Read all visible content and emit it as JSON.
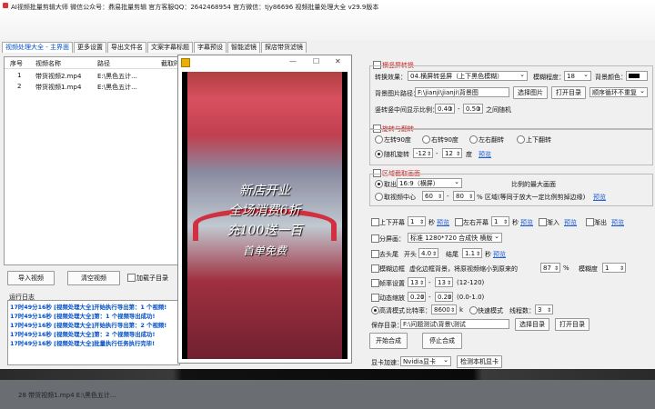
{
  "app": {
    "title": "AI视频批量剪辑大师   微信公众号：鼎易批量剪辑   官方客服QQ：2642468954   官方微信：tjy86696   视频批量处理大全  v29.9版本"
  },
  "tabs": [
    "视频处理大全 - 主界面",
    "更多设置",
    "导出文件名",
    "文案字幕标题",
    "字幕预设",
    "智能滤镜",
    "探店带货滤镜"
  ],
  "file_table": {
    "headers": [
      "序号",
      "视频名称",
      "路径",
      "截取时"
    ],
    "rows": [
      {
        "idx": "1",
        "name": "带货视频2.mp4",
        "path": "E:\\黑色五计..."
      },
      {
        "idx": "2",
        "name": "带货视频1.mp4",
        "path": "E:\\黑色五计..."
      }
    ]
  },
  "buttons": {
    "import": "导入视频",
    "clear": "清空视频",
    "add_subdir": "加载子目录",
    "select_image": "选择图片",
    "open_dir": "打开目录",
    "loop_mode": "顺序循环不重复",
    "start": "开始合成",
    "stop": "停止合成",
    "select_dir": "选择目录",
    "open_dir2": "打开目录",
    "detect_gpu": "检测本机显卡"
  },
  "log": {
    "label": "运行日志",
    "lines": [
      "17时49分16秒 [视频处理大全]开始执行导出第：1 个视频!",
      "17时49分16秒 [视频处理大全]第：1 个视频导出成功!",
      "17时49分16秒 [视频处理大全]开始执行导出第：2 个视频!",
      "17时49分16秒 [视频处理大全]第：2 个视频导出成功!",
      "17时49分16秒 [视频处理大全]批量执行任务执行完毕!"
    ]
  },
  "settings": {
    "h2v": {
      "title": "横竖屏转换",
      "mode_label": "转换效果：",
      "mode_value": "04.横屏转竖屏（上下黑色模糊）",
      "blur_label": "模糊程度：",
      "blur_value": "18",
      "bgcolor_label": "背景颜色：",
      "bgcolor": "#000000",
      "bgimg_label": "背景图片路径：",
      "bgimg_value": "F:\\jianji\\jianji\\背景图",
      "ratio_label": "竖转竖中间显示比例：",
      "ratio_min": "0.40",
      "ratio_max": "0.50",
      "ratio_suffix": "之间随机"
    },
    "rotate": {
      "title": "旋转与翻转",
      "opt1": "左转90度",
      "opt2": "右转90度",
      "opt3": "左右翻转",
      "opt4": "上下翻转",
      "opt5": "随机旋转",
      "min": "-12",
      "max": "12",
      "unit": "度",
      "preview": "预览"
    },
    "crop": {
      "title": "区域截取画面",
      "take_label": "取出",
      "take_value": "16:9（横屏）",
      "take_suffix": "比例的最大画面",
      "center_label": "取视频中心",
      "center_min": "60",
      "center_max": "80",
      "center_suffix": "% 区域(等同于放大一定比例剪掉边缘)",
      "preview": "预览"
    },
    "misc": {
      "top_bottom": "上下开幕",
      "top_bottom_val": "1",
      "top_bottom_unit": "秒",
      "left_right": "左右开幕",
      "left_right_val": "1",
      "left_right_unit": "秒",
      "fade_in": "渐入",
      "fade_out": "渐出",
      "preview": "预览",
      "split": "分屏画：",
      "split_value": "标准 1280*720 合成快 横版",
      "trim": "去头尾",
      "head_label": "开头",
      "head_val": "4.0",
      "tail_label": "结尾",
      "tail_val": "1.1",
      "trim_unit": "秒",
      "blur_border": "模糊边框",
      "blur_border_desc": "虚化边框背景，将原视频缩小到原来的",
      "blur_border_pct": "87",
      "blur_pct_unit": "%",
      "blur_deg_label": "模糊度",
      "blur_deg_val": "1",
      "fps": "帧率设置",
      "fps_min": "13",
      "fps_max": "13",
      "fps_range": "(12-120)",
      "zoom": "动态缩放",
      "zoom_min": "0.20",
      "zoom_max": "0.20",
      "zoom_range": "(0.0-1.0)",
      "hq": "高清模式",
      "bitrate_label": "比特率：",
      "bitrate_val": "8600",
      "bitrate_unit": "k",
      "fast": "快速模式",
      "threads_label": "线程数：",
      "threads_val": "3",
      "save_label": "保存目录：",
      "save_val": "F:\\问题测试\\背景\\测试",
      "gpu_label": "显卡加速：",
      "gpu_val": "Nvidia显卡"
    }
  },
  "video": {
    "title_ctrls": [
      "—",
      "☐",
      "✕"
    ],
    "captions": [
      "新店开业",
      "全场消费6折",
      "充100送一百",
      "首单免费"
    ]
  },
  "backdrop": {
    "bottom_row": "28    带货视频1.mp4       E:\\黑色五计..."
  }
}
